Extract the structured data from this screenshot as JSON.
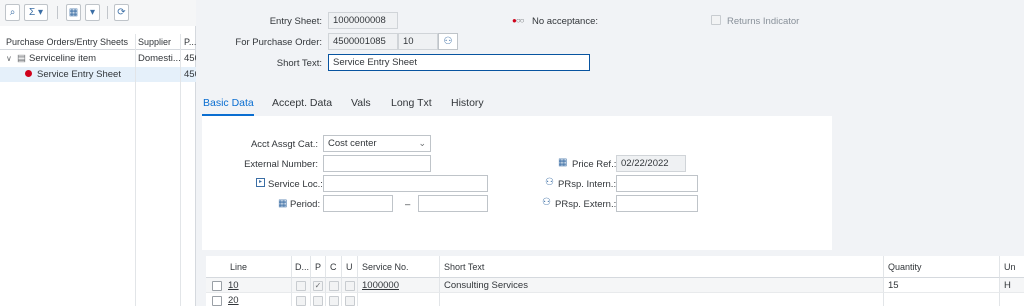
{
  "toolbar": {
    "buttons": [
      "find-icon",
      "sum-icon",
      "layout-icon",
      "refresh-icon"
    ]
  },
  "tree": {
    "columns": [
      "Purchase Orders/Entry Sheets",
      "Supplier",
      "P..."
    ],
    "rows": [
      {
        "expander": "∨",
        "label": "Serviceline item",
        "supplier": "Domesti...",
        "po": "450"
      },
      {
        "label": "Service Entry Sheet",
        "supplier": "",
        "po": "450",
        "status_color": "#d0021b"
      }
    ]
  },
  "header": {
    "entry_sheet_label": "Entry Sheet:",
    "entry_sheet_value": "1000000008",
    "acceptance_label": "No acceptance:",
    "returns_label": "Returns Indicator",
    "po_label": "For Purchase Order:",
    "po_value": "4500001085",
    "po_item": "10",
    "short_text_label": "Short Text:",
    "short_text_value": "Service Entry Sheet"
  },
  "tabs": [
    "Basic Data",
    "Accept. Data",
    "Vals",
    "Long Txt",
    "History"
  ],
  "active_tab": "Basic Data",
  "basic_data": {
    "acct_label": "Acct Assgt Cat.:",
    "acct_value": "Cost center",
    "external_label": "External Number:",
    "external_value": "",
    "service_loc_label": "Service Loc.:",
    "period_label": "Period:",
    "period_separator": "–",
    "price_ref_label": "Price Ref.:",
    "price_ref_value": "02/22/2022",
    "prsp_intern_label": "PRsp. Intern.:",
    "prsp_extern_label": "PRsp. Extern.:"
  },
  "table": {
    "columns": [
      "Line",
      "D...",
      "P",
      "C",
      "U",
      "Service No.",
      "Short Text",
      "Quantity",
      "Un"
    ],
    "rows": [
      {
        "line": "10",
        "service_no": "1000000",
        "short_text": "Consulting Services",
        "quantity": "15",
        "unit": "H"
      },
      {
        "line": "20",
        "service_no": "",
        "short_text": "",
        "quantity": "",
        "unit": ""
      }
    ]
  },
  "colors": {
    "accent": "#0a6ed1",
    "status_red": "#d0021b"
  }
}
